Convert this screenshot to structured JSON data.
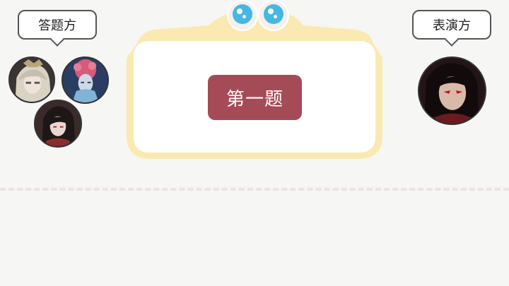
{
  "answer_side": {
    "label": "答题方"
  },
  "performer_side": {
    "label": "表演方"
  },
  "board": {
    "question_label": "第一题"
  },
  "colors": {
    "board_border": "#fbe9b2",
    "board_fill": "#ffffff",
    "question_button": "#a54b58",
    "eye_iris": "#46b7e2",
    "divider": "#ece3e3"
  },
  "avatars": {
    "answer_side": [
      "avatar-pale-hair",
      "avatar-pink-hair",
      "avatar-dark-hair"
    ],
    "performer_side": [
      "avatar-red-eyes"
    ]
  }
}
